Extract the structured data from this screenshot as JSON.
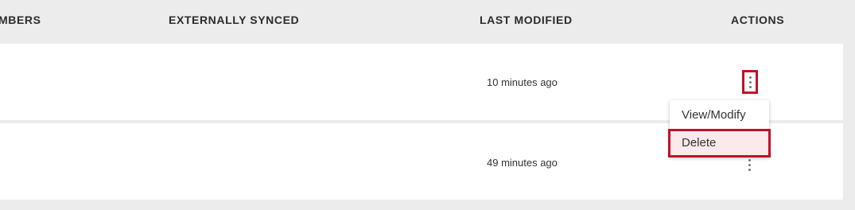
{
  "table": {
    "headers": {
      "members": "MBERS",
      "externally_synced": "EXTERNALLY SYNCED",
      "last_modified": "LAST MODIFIED",
      "actions": "ACTIONS"
    },
    "rows": [
      {
        "last_modified": "10 minutes ago"
      },
      {
        "last_modified": "49 minutes ago"
      }
    ]
  },
  "menu": {
    "items": [
      {
        "label": "View/Modify"
      },
      {
        "label": "Delete"
      }
    ]
  },
  "icons": {
    "actions": "more-vertical-icon"
  },
  "colors": {
    "highlight_border": "#c0112b",
    "highlight_fill": "#fbe9ec",
    "background": "#ececec",
    "row": "#ffffff"
  }
}
